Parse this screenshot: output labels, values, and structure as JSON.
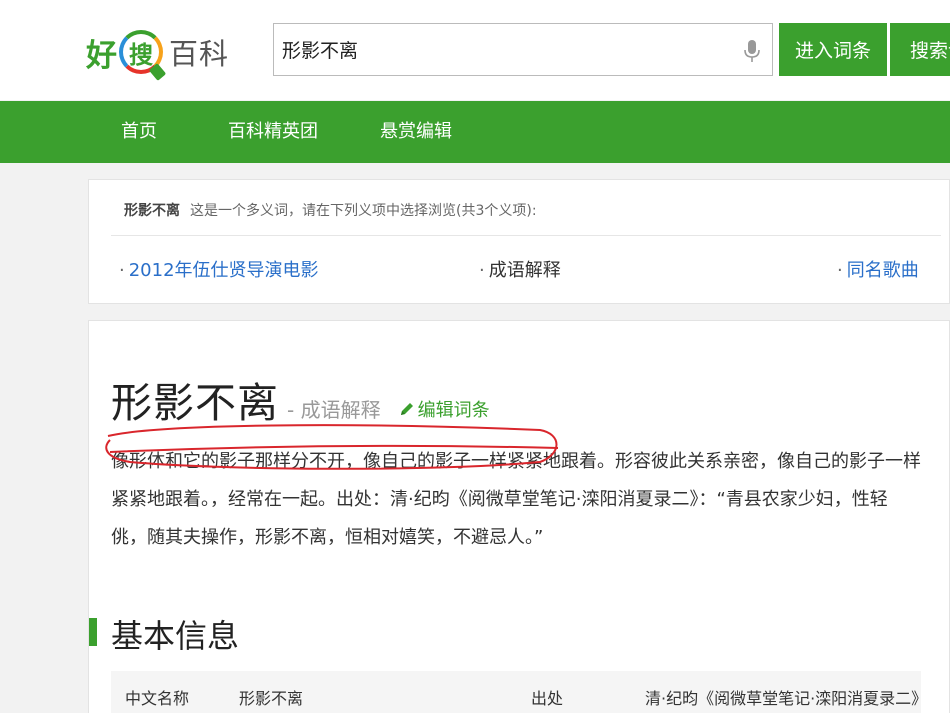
{
  "header": {
    "logo": {
      "part1": "好",
      "part2": "搜",
      "part3": "百科"
    },
    "search": {
      "value": "形影不离",
      "placeholder": ""
    },
    "enter_button": "进入词条",
    "search_button": "搜索词"
  },
  "nav": {
    "items": [
      {
        "label": "首页"
      },
      {
        "label": "百科精英团"
      },
      {
        "label": "悬赏编辑"
      }
    ]
  },
  "disambiguation": {
    "term": "形影不离",
    "note": "这是一个多义词，请在下列义项中选择浏览(共3个义项):",
    "senses": [
      {
        "label": "2012年伍仕贤导演电影"
      },
      {
        "label": "成语解释"
      },
      {
        "label": "同名歌曲"
      }
    ]
  },
  "article": {
    "title": "形影不离",
    "subtitle": "- 成语解释",
    "edit_label": "编辑词条",
    "summary": "像形体和它的影子那样分不开，像自己的影子一样紧紧地跟着。形容彼此关系亲密，像自己的影子一样紧紧地跟着。，经常在一起。出处：清·纪昀《阅微草堂笔记·滦阳消夏录二》：“青县农家少妇，性轻佻，随其夫操作，形影不离，恒相对嬉笑，不避忌人。”",
    "section_title": "基本信息",
    "info": {
      "label1": "中文名称",
      "value1": "形影不离",
      "label2": "出处",
      "value2": "清·纪昀《阅微草堂笔记·滦阳消夏录二》"
    }
  },
  "colors": {
    "brand_green": "#3ba02e",
    "link_blue": "#2a6fc9",
    "annotation_red": "#d9262c"
  },
  "icons": [
    "mic-icon",
    "pencil-icon"
  ]
}
